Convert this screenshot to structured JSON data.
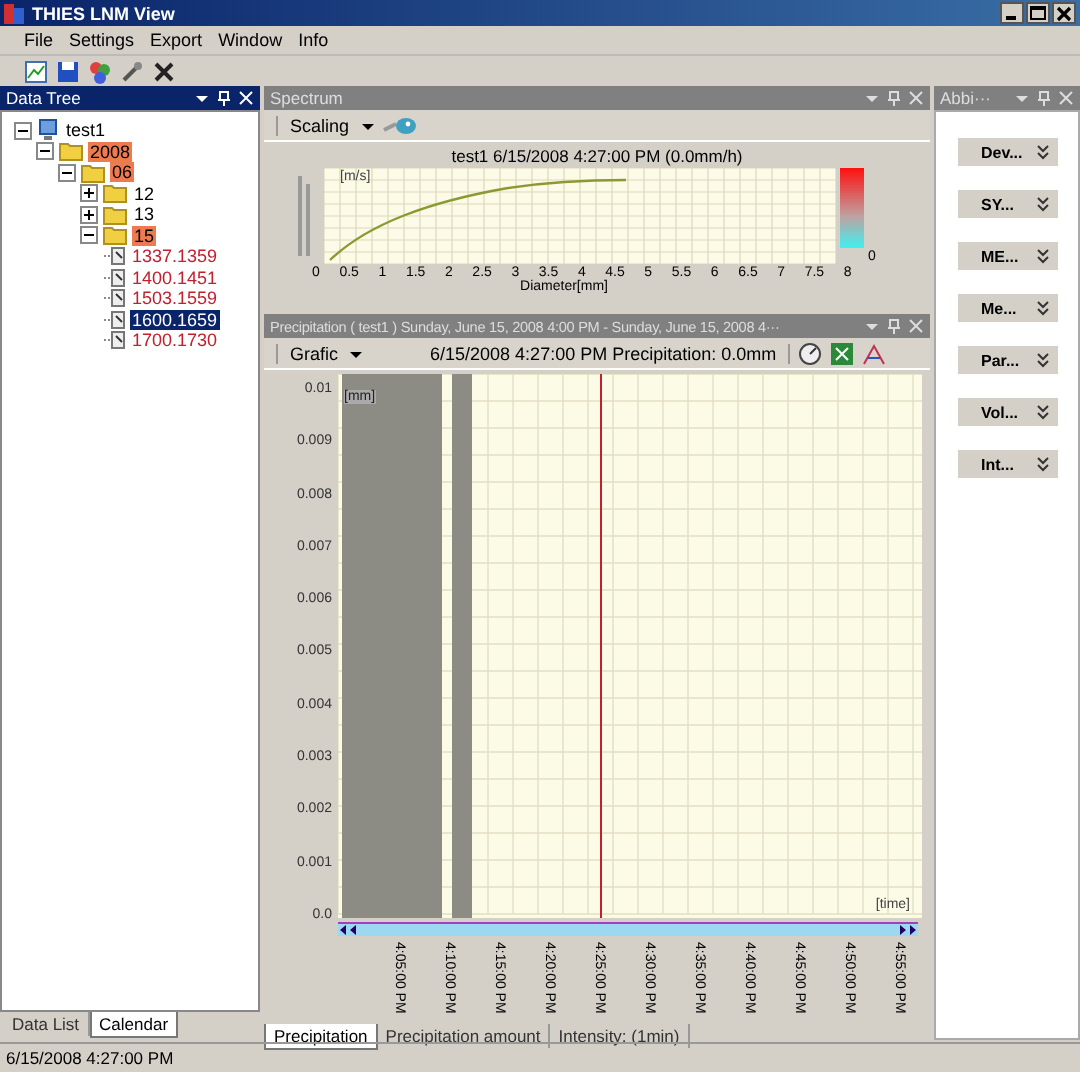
{
  "window": {
    "title": "THIES LNM View"
  },
  "menu": [
    "File",
    "Settings",
    "Export",
    "Window",
    "Info"
  ],
  "data_tree": {
    "title": "Data Tree",
    "items": [
      {
        "label": "test1",
        "kind": "station",
        "expanded": true,
        "highlighted": false,
        "children": [
          {
            "label": "2008",
            "kind": "folder",
            "expanded": true,
            "highlighted": true,
            "children": [
              {
                "label": "06",
                "kind": "folder",
                "expanded": true,
                "highlighted": true,
                "children": [
                  {
                    "label": "12",
                    "kind": "folder",
                    "expanded": false,
                    "highlighted": false
                  },
                  {
                    "label": "13",
                    "kind": "folder",
                    "expanded": false,
                    "highlighted": false
                  },
                  {
                    "label": "15",
                    "kind": "folder",
                    "expanded": true,
                    "highlighted": true,
                    "children": [
                      {
                        "label": "1337.1359",
                        "kind": "record",
                        "selected": false
                      },
                      {
                        "label": "1400.1451",
                        "kind": "record",
                        "selected": false
                      },
                      {
                        "label": "1503.1559",
                        "kind": "record",
                        "selected": false
                      },
                      {
                        "label": "1600.1659",
                        "kind": "record",
                        "selected": true
                      },
                      {
                        "label": "1700.1730",
                        "kind": "record",
                        "selected": false
                      }
                    ]
                  }
                ]
              }
            ]
          }
        ]
      }
    ],
    "tabs": [
      {
        "label": "Data List",
        "selected": false
      },
      {
        "label": "Calendar",
        "selected": true
      }
    ]
  },
  "spectrum": {
    "title": "Spectrum",
    "scaling_button": "Scaling",
    "chart_title": "test1 6/15/2008 4:27:00 PM (0.0mm/h)",
    "y_unit": "[m/s]",
    "x_tick_labels": [
      "0",
      "0.5",
      "1",
      "1.5",
      "2",
      "2.5",
      "3",
      "3.5",
      "4",
      "4.5",
      "5",
      "5.5",
      "6",
      "6.5",
      "7",
      "7.5",
      "8"
    ],
    "x_label": "Diameter[mm]",
    "colorbar_label": "0"
  },
  "precipitation": {
    "title": "Precipitation ( test1 ) Sunday, June 15, 2008 4:00 PM - Sunday, June 15, 2008 4···",
    "grafic_button": "Grafic",
    "info": "6/15/2008 4:27:00 PM Precipitation: 0.0mm",
    "y_unit": "[mm]",
    "x_unit": "[time]",
    "y_tick_labels": [
      "0.01",
      "0.009",
      "0.008",
      "0.007",
      "0.006",
      "0.005",
      "0.004",
      "0.003",
      "0.002",
      "0.001",
      "0.0"
    ],
    "x_tick_labels": [
      "4:05:00 PM",
      "4:10:00 PM",
      "4:15:00 PM",
      "4:20:00 PM",
      "4:25:00 PM",
      "4:30:00 PM",
      "4:35:00 PM",
      "4:40:00 PM",
      "4:45:00 PM",
      "4:50:00 PM",
      "4:55:00 PM"
    ],
    "tabs": [
      {
        "label": "Precipitation",
        "selected": true
      },
      {
        "label": "Precipitation amount",
        "selected": false
      },
      {
        "label": "Intensity: (1min)",
        "selected": false
      }
    ]
  },
  "side_panel": {
    "title": "Abbi···",
    "buttons": [
      "Dev...",
      "SY...",
      "ME...",
      "Me...",
      "Par...",
      "Vol...",
      "Int..."
    ]
  },
  "status_bar": "6/15/2008 4:27:00 PM"
}
